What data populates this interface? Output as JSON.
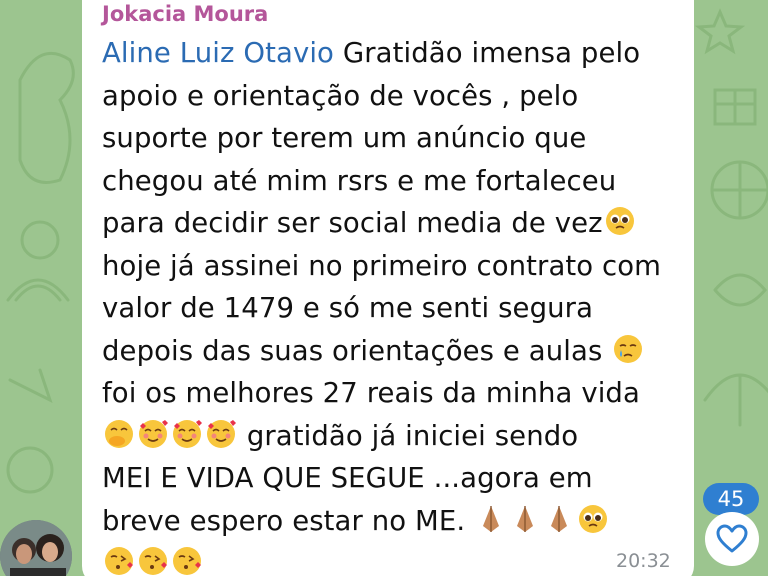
{
  "chat": {
    "sender_name": "Jokacia Moura",
    "mention": "Aline Luiz Otavio",
    "lines": [
      " Gratidão imensa pelo",
      "apoio e orientação de vocês , pelo",
      "suporte por terem um anúncio que",
      "chegou até mim rsrs e me fortaleceu",
      "para decidir ser social media de vez",
      "hoje já assinei no primeiro contrato com",
      "valor de 1479 e só me senti segura",
      "depois das suas orientações e aulas ",
      "foi os melhores 27 reais da minha vida",
      " gratidão já iniciei sendo",
      "MEI E VIDA QUE SEGUE ...agora em",
      "breve espero estar no ME. "
    ],
    "time": "20:32",
    "unread_count": "45"
  },
  "icons": {
    "avatar": "user-avatar-photo",
    "reaction": "heart-icon",
    "emojis": [
      "pleading-face",
      "face-holding-back-tears",
      "hand-over-mouth",
      "smiling-face-with-hearts",
      "folded-hands",
      "face-blowing-kiss"
    ]
  },
  "colors": {
    "wallpaper": "#9cc58f",
    "sender_name": "#b4569a",
    "mention": "#2b6bb3",
    "badge": "#2f7fd1",
    "time": "#8a8f94"
  }
}
